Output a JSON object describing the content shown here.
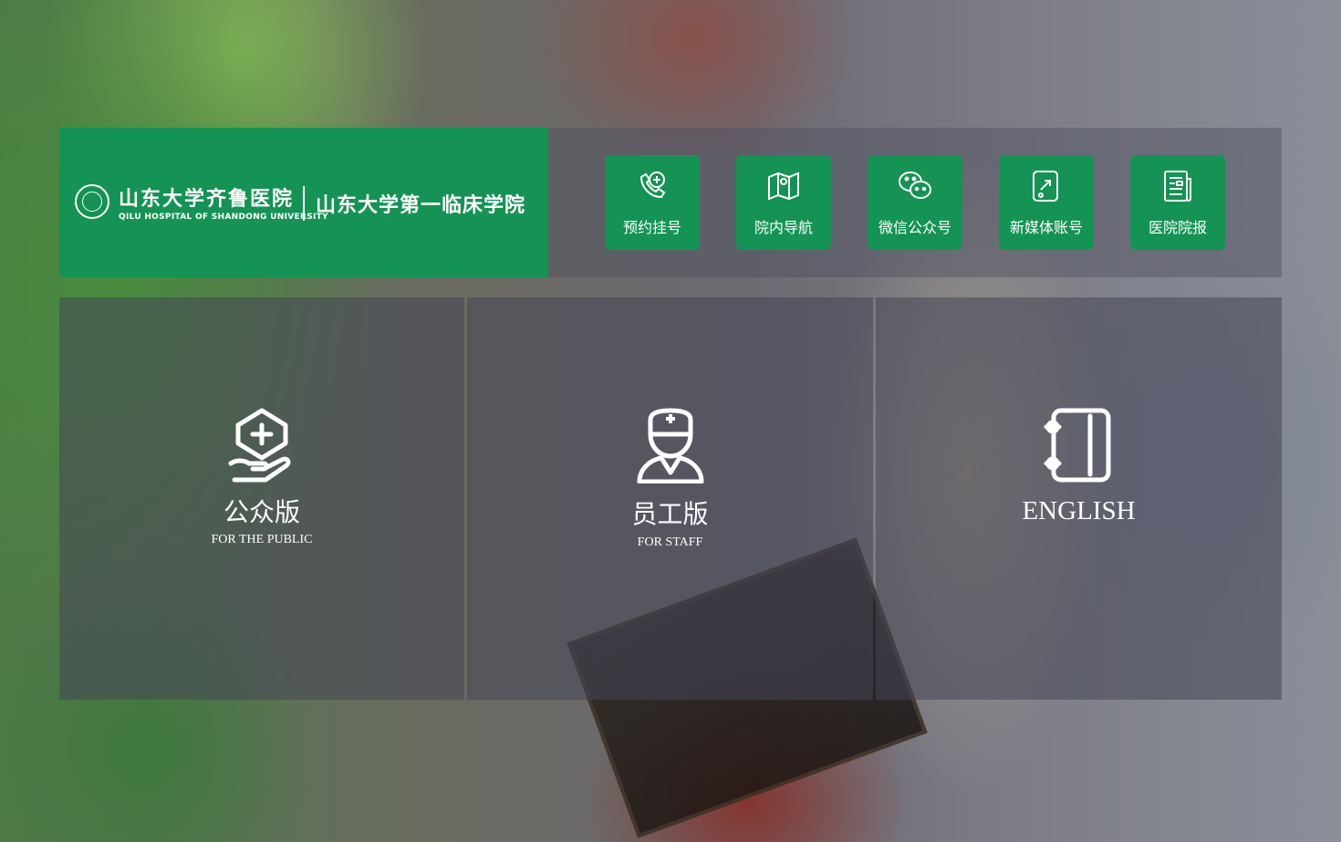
{
  "header": {
    "logo": {
      "name_cn": "山东大学齐鲁医院",
      "name_en": "QILU HOSPITAL OF SHANDONG UNIVERSITY",
      "college_cn": "山东大学第一临床学院"
    },
    "quick_links": [
      {
        "label": "预约挂号",
        "icon": "phone-plus-icon"
      },
      {
        "label": "院内导航",
        "icon": "map-icon"
      },
      {
        "label": "微信公众号",
        "icon": "wechat-icon"
      },
      {
        "label": "新媒体账号",
        "icon": "media-account-icon"
      },
      {
        "label": "医院院报",
        "icon": "newspaper-icon"
      }
    ]
  },
  "portals": [
    {
      "title": "公众版",
      "subtitle": "FOR THE PUBLIC",
      "icon": "hand-medical-icon"
    },
    {
      "title": "员工版",
      "subtitle": "FOR STAFF",
      "icon": "doctor-icon"
    },
    {
      "title": "ENGLISH",
      "subtitle": "",
      "icon": "notebook-icon"
    }
  ],
  "colors": {
    "brand_green": "#149354",
    "overlay": "rgba(70,70,85,0.55)",
    "text": "#ffffff"
  }
}
